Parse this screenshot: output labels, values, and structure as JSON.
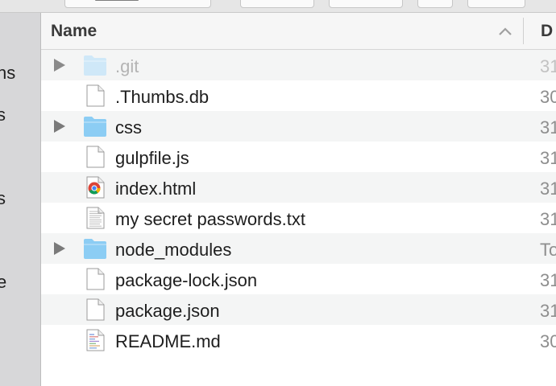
{
  "sidebar": {
    "labels": [
      "ns",
      "s",
      "s",
      "e"
    ]
  },
  "header": {
    "name_label": "Name",
    "date_label": "D"
  },
  "files": [
    {
      "name": ".git",
      "date": "31",
      "type": "folder",
      "expandable": true,
      "dimmed": true
    },
    {
      "name": ".Thumbs.db",
      "date": "30",
      "type": "file",
      "expandable": false,
      "dimmed": false
    },
    {
      "name": "css",
      "date": "31",
      "type": "folder",
      "expandable": true,
      "dimmed": false
    },
    {
      "name": "gulpfile.js",
      "date": "31",
      "type": "file",
      "expandable": false,
      "dimmed": false
    },
    {
      "name": "index.html",
      "date": "31",
      "type": "html",
      "expandable": false,
      "dimmed": false
    },
    {
      "name": "my secret passwords.txt",
      "date": "31",
      "type": "text",
      "expandable": false,
      "dimmed": false
    },
    {
      "name": "node_modules",
      "date": "To",
      "type": "folder",
      "expandable": true,
      "dimmed": false
    },
    {
      "name": "package-lock.json",
      "date": "31",
      "type": "file",
      "expandable": false,
      "dimmed": false
    },
    {
      "name": "package.json",
      "date": "31",
      "type": "file",
      "expandable": false,
      "dimmed": false
    },
    {
      "name": "README.md",
      "date": "30",
      "type": "markdown",
      "expandable": false,
      "dimmed": false
    }
  ],
  "colors": {
    "folder": "#8ccdf4",
    "folder_dim": "#cfe8f8",
    "row_alt": "#f4f5f5",
    "sidebar": "#d7d7d9"
  }
}
